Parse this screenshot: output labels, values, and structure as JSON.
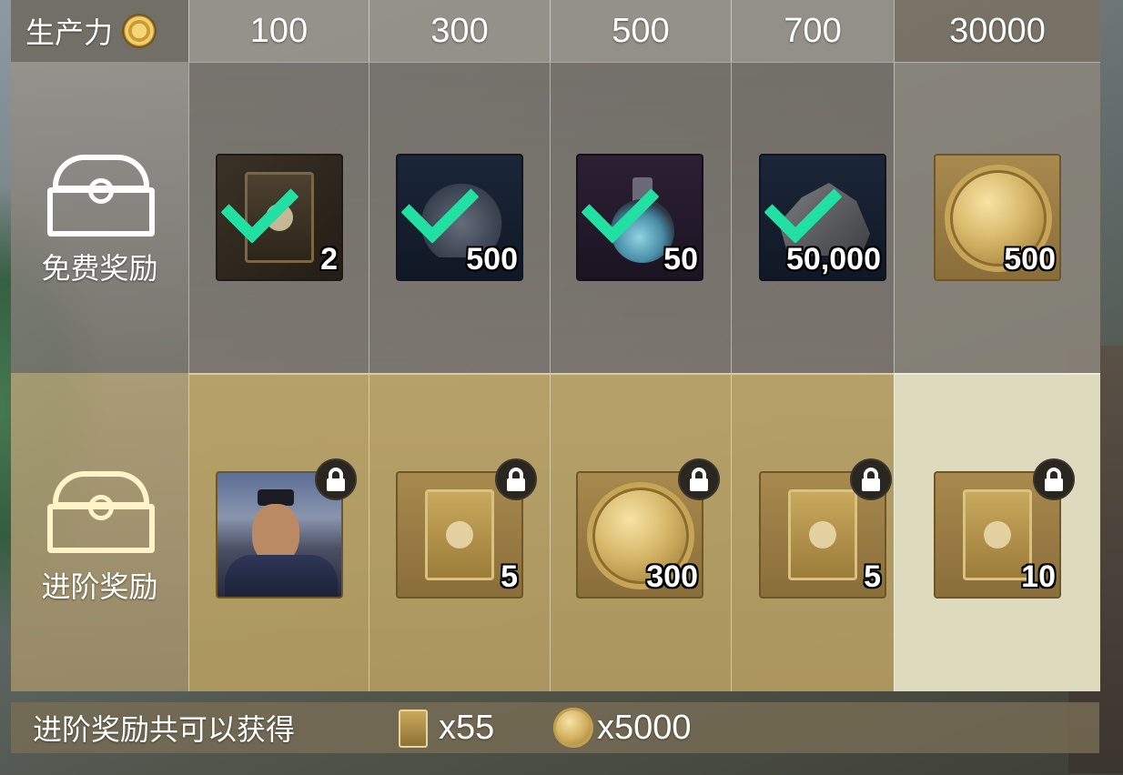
{
  "header": {
    "label": "生产力",
    "thresholds": [
      "100",
      "300",
      "500",
      "700",
      "30000"
    ]
  },
  "rows": {
    "free": {
      "label": "免费奖励",
      "items": [
        {
          "icon": "card-icon",
          "qty": "2",
          "claimed": true
        },
        {
          "icon": "badge-icon",
          "qty": "500",
          "claimed": true
        },
        {
          "icon": "potion-icon",
          "qty": "50",
          "claimed": true
        },
        {
          "icon": "ore-icon",
          "qty": "50,000",
          "claimed": true
        },
        {
          "icon": "coin-icon",
          "qty": "500",
          "claimed": false
        }
      ]
    },
    "advanced": {
      "label": "进阶奖励",
      "items": [
        {
          "icon": "hero-portrait-icon",
          "qty": "",
          "locked": true
        },
        {
          "icon": "card-icon",
          "qty": "5",
          "locked": true
        },
        {
          "icon": "coin-icon",
          "qty": "300",
          "locked": true
        },
        {
          "icon": "card-icon",
          "qty": "5",
          "locked": true
        },
        {
          "icon": "card-icon",
          "qty": "10",
          "locked": true
        }
      ]
    }
  },
  "footer": {
    "label": "进阶奖励共可以获得",
    "card_total": "x55",
    "coin_total": "x5000"
  },
  "colors": {
    "check": "#22e0a2",
    "advanced_highlight": "#dedabe"
  }
}
